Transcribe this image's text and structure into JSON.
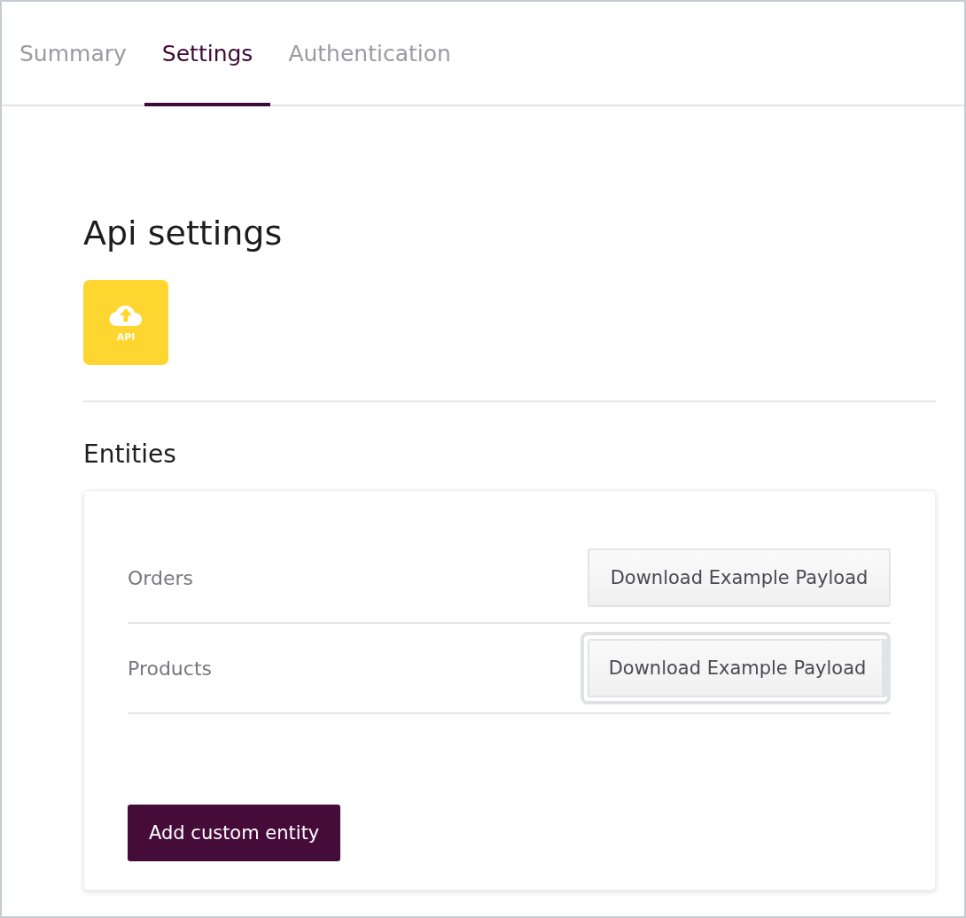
{
  "tabs": [
    {
      "label": "Summary",
      "selected": false
    },
    {
      "label": "Settings",
      "selected": true
    },
    {
      "label": "Authentication",
      "selected": false
    }
  ],
  "title": "Api settings",
  "api_tile": {
    "label": "API"
  },
  "entities_heading": "Entities",
  "entities": [
    {
      "name": "Orders",
      "button": "Download Example Payload",
      "focused": false
    },
    {
      "name": "Products",
      "button": "Download Example Payload",
      "focused": true
    }
  ],
  "add_button": "Add custom entity"
}
